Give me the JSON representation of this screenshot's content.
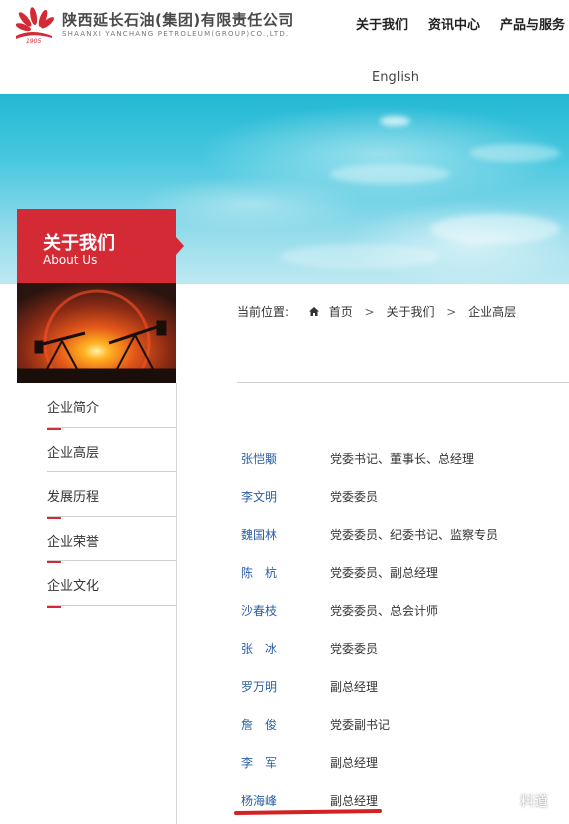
{
  "header": {
    "brand_cn": "陕西延长石油(集团)有限责任公司",
    "brand_en": "SHAANXI YANCHANG PETROLEUM(GROUP)CO.,LTD.",
    "logo_year": "1905",
    "nav": [
      "关于我们",
      "资讯中心",
      "产品与服务"
    ],
    "language": "English"
  },
  "about_tab": {
    "title_cn": "关于我们",
    "title_en": "About Us"
  },
  "sidebar": {
    "items": [
      {
        "label": "企业简介"
      },
      {
        "label": "企业高层"
      },
      {
        "label": "发展历程"
      },
      {
        "label": "企业荣誉"
      },
      {
        "label": "企业文化"
      }
    ]
  },
  "breadcrumb": {
    "prefix": "当前位置:",
    "home": "首页",
    "separator": ">",
    "level1": "关于我们",
    "level2": "企业高层"
  },
  "leaders": [
    {
      "name": "张恺颙",
      "title": "党委书记、董事长、总经理"
    },
    {
      "name": "李文明",
      "title": "党委委员"
    },
    {
      "name": "魏国林",
      "title": "党委委员、纪委书记、监察专员"
    },
    {
      "name": "陈　杭",
      "title": "党委委员、副总经理"
    },
    {
      "name": "沙春枝",
      "title": "党委委员、总会计师"
    },
    {
      "name": "张　冰",
      "title": "党委委员"
    },
    {
      "name": "罗万明",
      "title": "副总经理"
    },
    {
      "name": "詹　俊",
      "title": "党委副书记"
    },
    {
      "name": "李　军",
      "title": "副总经理"
    },
    {
      "name": "杨海峰",
      "title": "副总经理"
    }
  ],
  "watermark": "料道",
  "colors": {
    "accent_red": "#d42a36",
    "link_blue": "#2a5fa5",
    "sky": "#22b8d4"
  }
}
